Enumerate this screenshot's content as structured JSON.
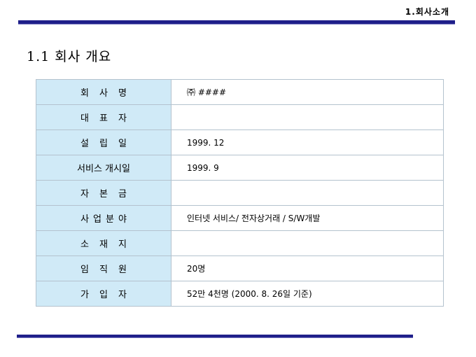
{
  "header": {
    "label": "1.회사소개"
  },
  "section": {
    "title": "1.1 회사 개요"
  },
  "rows": [
    {
      "label": "회사명",
      "value": "㈜ ####"
    },
    {
      "label": "대표자",
      "value": ""
    },
    {
      "label": "설립일",
      "value": "1999. 12"
    },
    {
      "label": "서비스 개시일",
      "value": "1999. 9"
    },
    {
      "label": "자본금",
      "value": ""
    },
    {
      "label": "사업분야",
      "value": "인터넷 서비스/ 전자상거래 / S/W개발"
    },
    {
      "label": "소재지",
      "value": ""
    },
    {
      "label": "임직원",
      "value": "20명"
    },
    {
      "label": "가입자",
      "value": "52만 4천명 (2000. 8. 26일 기준)"
    }
  ]
}
